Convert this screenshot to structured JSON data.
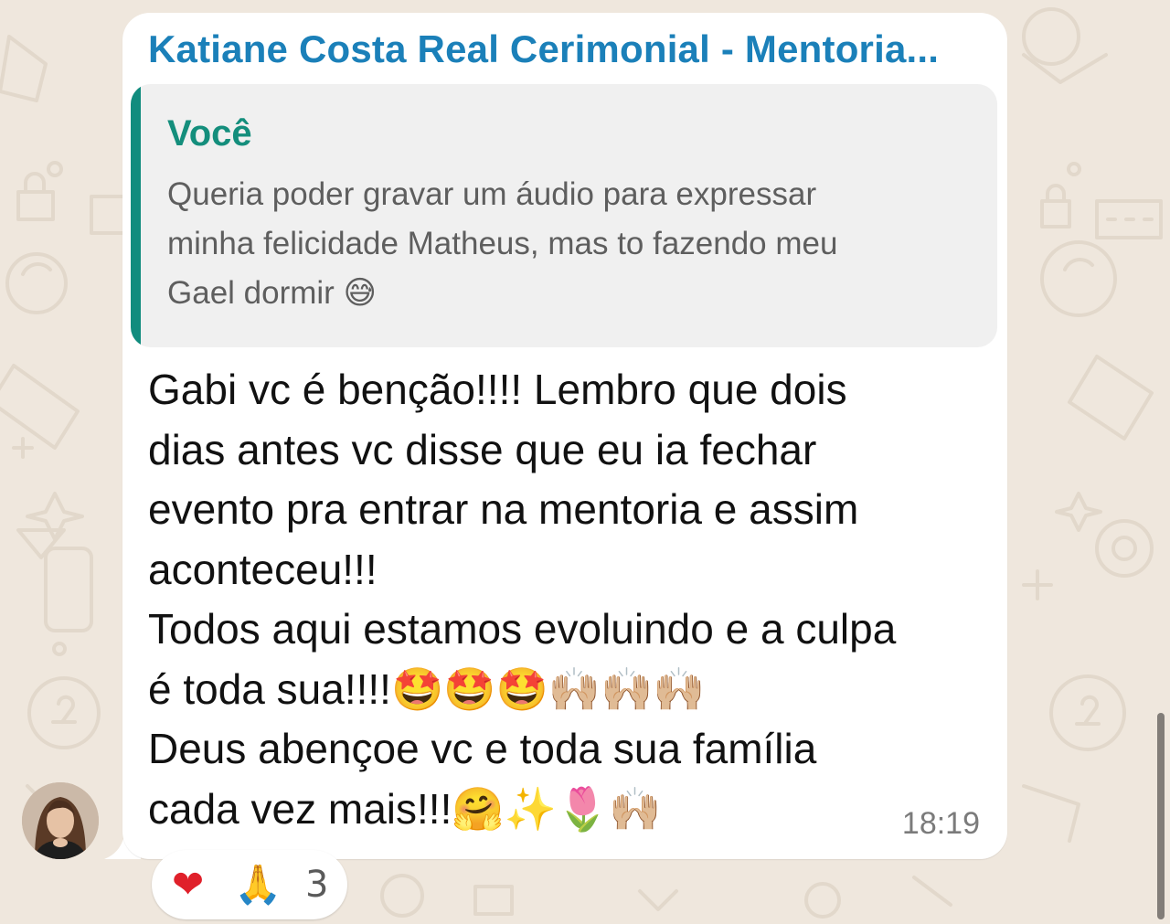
{
  "message": {
    "sender": "Katiane Costa Real Cerimonial - Mentoria...",
    "quote": {
      "author": "Você",
      "text": "Queria poder gravar um áudio para expressar\nminha felicidade Matheus, mas to fazendo meu\nGael dormir 😅"
    },
    "body": "Gabi vc é benção!!!! Lembro que dois\ndias antes vc disse que eu ia fechar\nevento pra entrar na mentoria e assim\naconteceu!!!\nTodos aqui estamos evoluindo e a culpa\né toda sua!!!!🤩🤩🤩🙌🏼🙌🏼🙌🏼\nDeus abençoe vc e toda sua família\ncada vez mais!!!🤗✨🌷🙌🏼",
    "time": "18:19"
  },
  "reactions": {
    "first": "❤",
    "second": "🙏",
    "count": "3"
  },
  "colors": {
    "sender": "#1b80b9",
    "quote_author": "#148e7c",
    "quote_bar": "#118c7e",
    "wallpaper": "#efe7dd"
  },
  "icons": [
    "avatar-photo",
    "heart-reaction-icon",
    "pray-reaction-icon"
  ]
}
